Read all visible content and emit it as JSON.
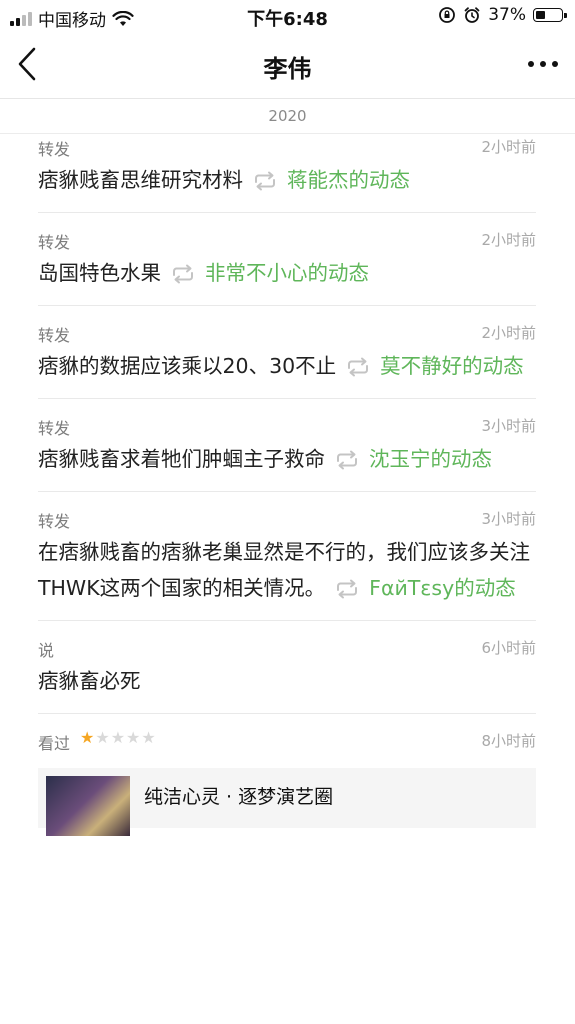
{
  "status_bar": {
    "carrier": "中国移动",
    "time": "下午6:48",
    "battery_percent": "37%",
    "battery_level": 0.37,
    "icons": [
      "signal-icon",
      "wifi-icon",
      "lock-rotation-icon",
      "alarm-icon",
      "battery-icon"
    ]
  },
  "nav": {
    "title": "李伟",
    "back_icon": "chevron-left-icon",
    "more_icon": "more-dots-icon"
  },
  "year": "2020",
  "feed": [
    {
      "type": "转发",
      "time": "2小时前",
      "text": "痞貅贱畜思维研究材料",
      "link": "蒋能杰的动态"
    },
    {
      "type": "转发",
      "time": "2小时前",
      "text": "岛国特色水果",
      "link": "非常不小心的动态"
    },
    {
      "type": "转发",
      "time": "2小时前",
      "text": "痞貅的数据应该乘以20、30不止",
      "link": "莫不静好的动态"
    },
    {
      "type": "转发",
      "time": "3小时前",
      "text": "痞貅贱畜求着牠们肿蝈主子救命",
      "link": "沈玉宁的动态"
    },
    {
      "type": "转发",
      "time": "3小时前",
      "text": "在痞貅贱畜的痞貅老巢显然是不行的，我们应该多关注THWK这两个国家的相关情况。",
      "link": "FαйTεsy的动态"
    },
    {
      "type": "说",
      "time": "6小时前",
      "text": "痞貅畜必死",
      "link": ""
    }
  ],
  "watched": {
    "type": "看过",
    "time": "8小时前",
    "rating": 1,
    "rating_max": 5,
    "card_title": "纯洁心灵 · 逐梦演艺圈"
  },
  "colors": {
    "accent_green": "#5fb65a",
    "star": "#f5a623"
  }
}
